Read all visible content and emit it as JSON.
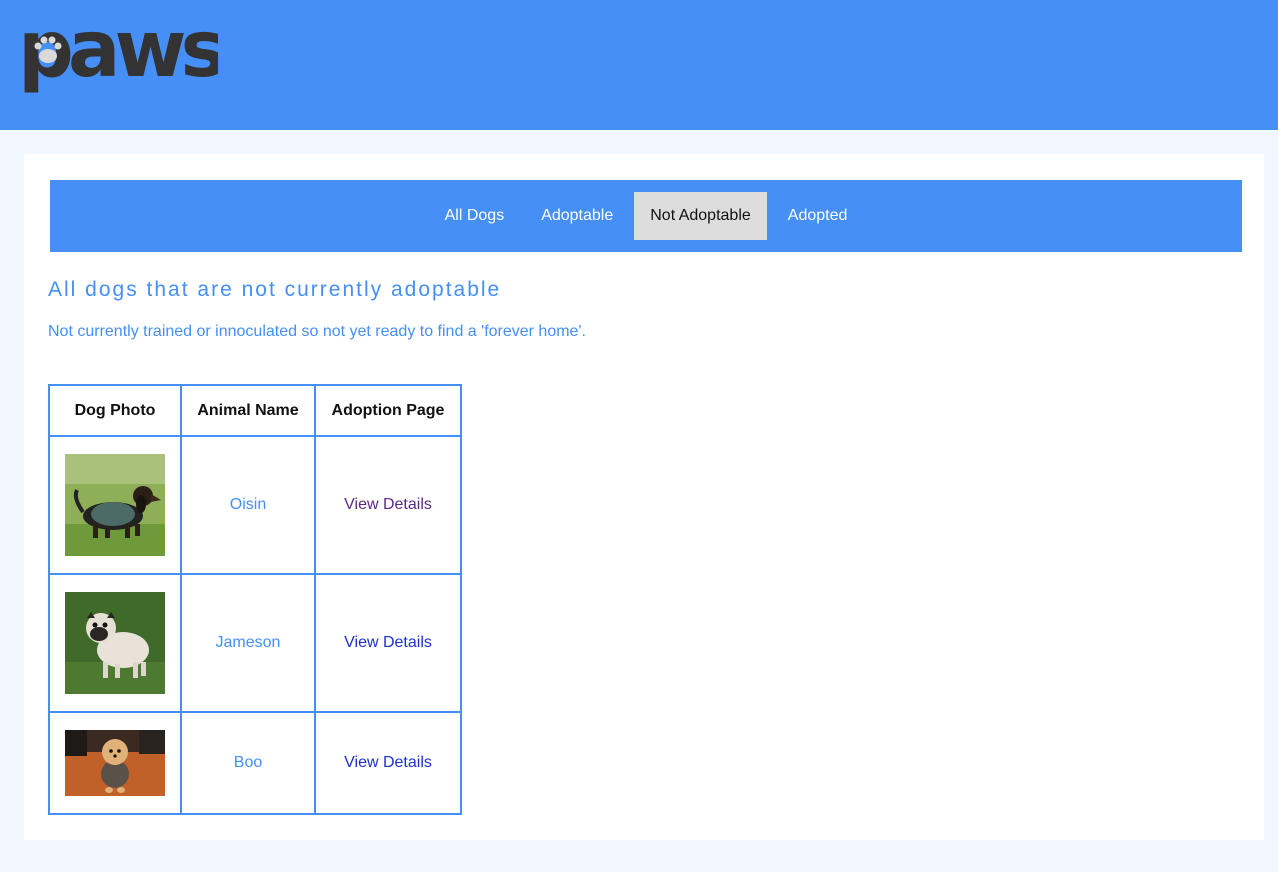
{
  "app": {
    "logo_text": "paws",
    "logo_color": "#333333",
    "brand_color": "#458ff6"
  },
  "nav": {
    "tabs": [
      {
        "label": "All Dogs",
        "active": false
      },
      {
        "label": "Adoptable",
        "active": false
      },
      {
        "label": "Not Adoptable",
        "active": true
      },
      {
        "label": "Adopted",
        "active": false
      }
    ]
  },
  "main": {
    "title": "All dogs that are not currently adoptable",
    "subtitle": "Not currently trained or innoculated so not yet ready to find a 'forever home'.",
    "table": {
      "headers": [
        "Dog Photo",
        "Animal Name",
        "Adoption Page"
      ],
      "rows": [
        {
          "photo": "dachshund-in-sweater-photo",
          "name": "Oisin",
          "link": "View Details",
          "visited": true
        },
        {
          "photo": "pug-photo",
          "name": "Jameson",
          "link": "View Details",
          "visited": false
        },
        {
          "photo": "pomeranian-photo",
          "name": "Boo",
          "link": "View Details",
          "visited": false
        }
      ]
    }
  }
}
